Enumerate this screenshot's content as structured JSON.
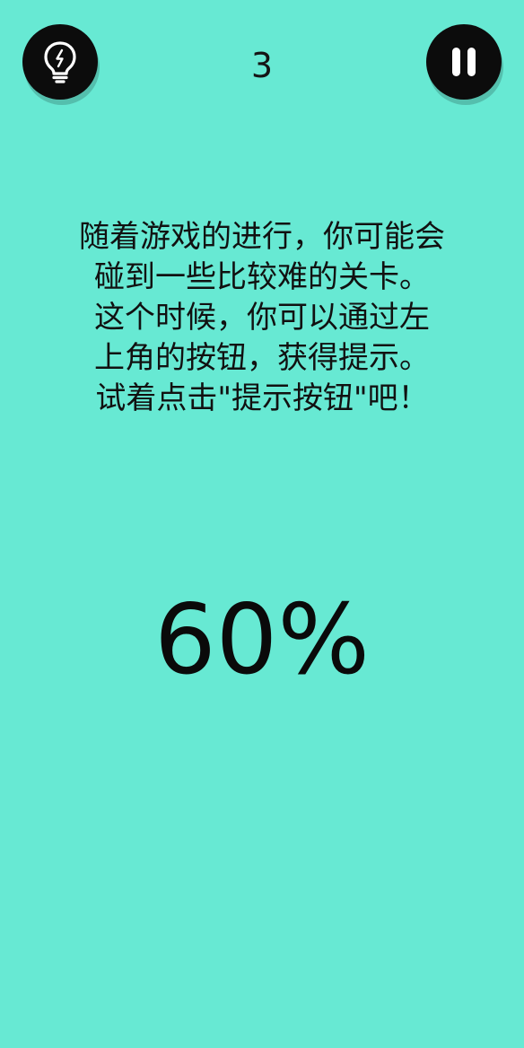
{
  "header": {
    "hint_button": {
      "icon": "lightbulb-icon"
    },
    "level_number": "3",
    "pause_button": {
      "icon": "pause-icon"
    }
  },
  "tutorial": {
    "lines": [
      "随着游戏的进行，你可能会",
      "碰到一些比较难的关卡。",
      "这个时候，你可以通过左",
      "上角的按钮，获得提示。",
      "试着点击\"提示按钮\"吧！"
    ]
  },
  "progress_text": "60%",
  "colors": {
    "background": "#67e9d3",
    "button_fill": "#0c0c0c",
    "icon": "#ffffff",
    "text": "#111111"
  }
}
